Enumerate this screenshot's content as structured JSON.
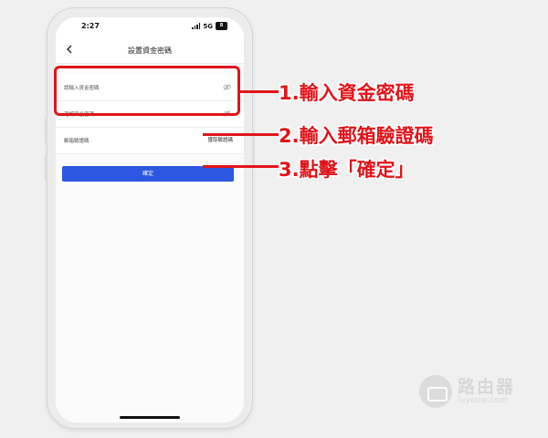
{
  "status_bar": {
    "time": "2:27",
    "network": "5G",
    "battery": "8"
  },
  "nav": {
    "title": "設置資金密碼"
  },
  "form": {
    "fields": [
      {
        "label": "請輸入資金密碼"
      },
      {
        "label": "確認資金密碼"
      },
      {
        "label": "郵箱驗證碼",
        "action": "獲取驗證碼"
      }
    ],
    "confirm_label": "確定"
  },
  "annotations": {
    "step1": "1.輸入資金密碼",
    "step2": "2.輸入郵箱驗證碼",
    "step3": "3.點擊「確定」",
    "color": "#e0151b"
  },
  "watermark": {
    "name": "路由器",
    "url": "luyouqi.com"
  },
  "colors": {
    "primary_button": "#2d57e0",
    "background": "#f0f0f0"
  }
}
